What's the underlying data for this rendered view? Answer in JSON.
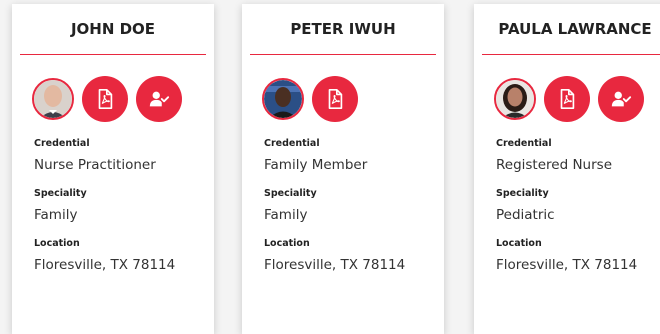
{
  "cards": [
    {
      "name": "JOHN DOE",
      "credential_label": "Credential",
      "credential": "Nurse Practitioner",
      "speciality_label": "Speciality",
      "speciality": "Family",
      "location_label": "Location",
      "location": "Floresville, TX 78114",
      "avatar_icon": "avatar-photo-older-man",
      "actions": [
        "pdf-document-icon",
        "user-check-icon"
      ]
    },
    {
      "name": "PETER IWUH",
      "credential_label": "Credential",
      "credential": "Family Member",
      "speciality_label": "Speciality",
      "speciality": "Family",
      "location_label": "Location",
      "location": "Floresville, TX 78114",
      "avatar_icon": "avatar-photo-man",
      "actions": [
        "pdf-document-icon"
      ]
    },
    {
      "name": "PAULA LAWRANCE",
      "credential_label": "Credential",
      "credential": "Registered Nurse",
      "speciality_label": "Speciality",
      "speciality": "Pediatric",
      "location_label": "Location",
      "location": "Floresville, TX 78114",
      "avatar_icon": "avatar-photo-woman",
      "actions": [
        "pdf-document-icon",
        "user-check-icon"
      ]
    }
  ],
  "colors": {
    "accent": "#e8283f",
    "card_bg": "#ffffff",
    "page_bg": "#f4f4f4",
    "text": "#222222"
  }
}
